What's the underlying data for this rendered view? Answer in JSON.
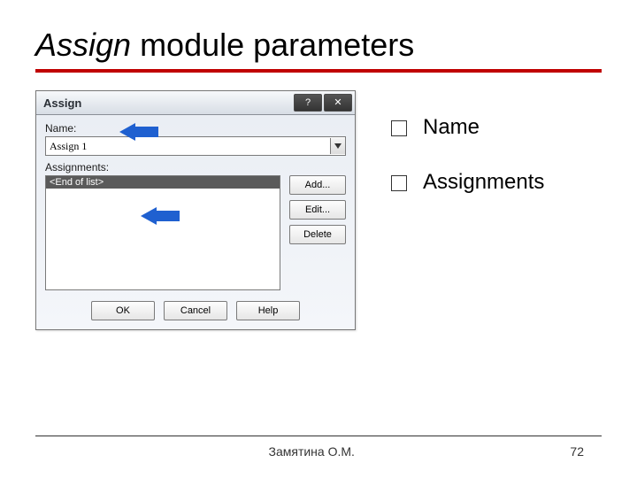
{
  "title_italic": "Assign",
  "title_rest": " module parameters",
  "dialog": {
    "title": "Assign",
    "name_label": "Name:",
    "name_value": "Assign 1",
    "assignments_label": "Assignments:",
    "list_first": "<End of list>",
    "buttons": {
      "add": "Add...",
      "edit": "Edit...",
      "delete": "Delete"
    },
    "bottom": {
      "ok": "OK",
      "cancel": "Cancel",
      "help": "Help"
    }
  },
  "bullets": [
    {
      "label": "Name"
    },
    {
      "label": "Assignments"
    }
  ],
  "footer": {
    "author": "Замятина О.М.",
    "page": "72"
  }
}
